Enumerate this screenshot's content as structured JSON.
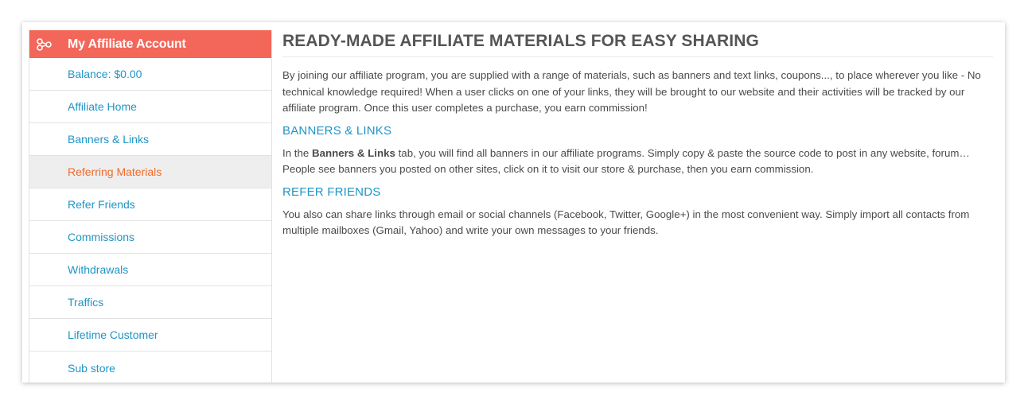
{
  "sidebar": {
    "title": "My Affiliate Account",
    "accent_color": "#f2675a",
    "icon": "affiliate-network-icon",
    "items": [
      {
        "label": "Balance: $0.00",
        "active": false
      },
      {
        "label": "Affiliate Home",
        "active": false
      },
      {
        "label": "Banners & Links",
        "active": false
      },
      {
        "label": "Referring Materials",
        "active": true
      },
      {
        "label": "Refer Friends",
        "active": false
      },
      {
        "label": "Commissions",
        "active": false
      },
      {
        "label": "Withdrawals",
        "active": false
      },
      {
        "label": "Traffics",
        "active": false
      },
      {
        "label": "Lifetime Customer",
        "active": false
      },
      {
        "label": "Sub store",
        "active": false
      }
    ]
  },
  "main": {
    "title": "READY-MADE AFFILIATE MATERIALS FOR EASY SHARING",
    "intro": "By joining our affiliate program, you are supplied with a range of materials, such as banners and text links, coupons..., to place wherever you like - No technical knowledge required! When a user clicks on one of your links, they will be brought to our website and their activities will be tracked by our affiliate program. Once this user completes a purchase, you earn commission!",
    "section1": {
      "heading": "BANNERS & LINKS",
      "text_before": "In the ",
      "text_bold": "Banners & Links",
      "text_after": " tab, you will find all banners in our affiliate programs. Simply copy & paste the source code to post in any website, forum… People see banners you posted on other sites, click on it to visit our store & purchase, then you earn commission."
    },
    "section2": {
      "heading": "REFER FRIENDS",
      "text": "You also can share links through email or social channels (Facebook, Twitter, Google+) in the most convenient way. Simply import all contacts from multiple mailboxes (Gmail, Yahoo) and write your own messages to your friends."
    }
  }
}
